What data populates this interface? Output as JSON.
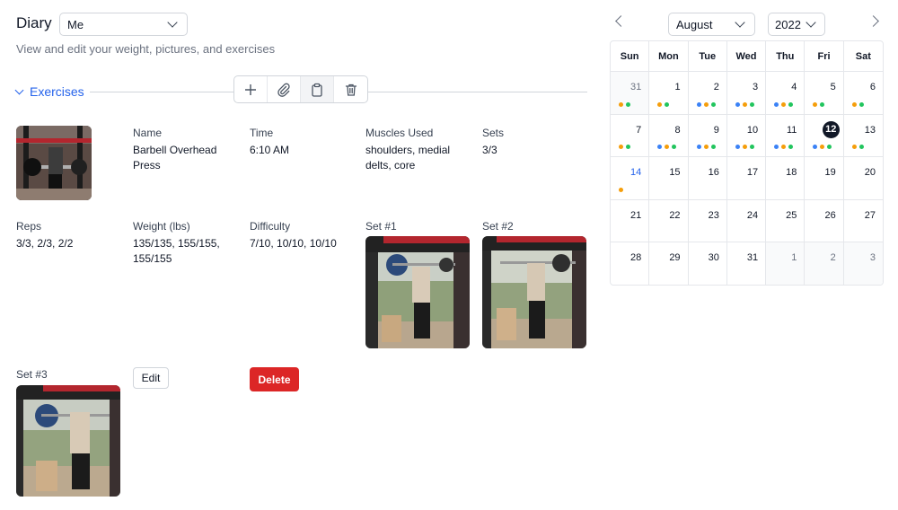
{
  "header": {
    "title": "Diary",
    "user_select": "Me",
    "subtitle": "View and edit your weight, pictures, and exercises"
  },
  "section": {
    "label": "Exercises",
    "toolbar": [
      {
        "name": "add-icon"
      },
      {
        "name": "attach-icon"
      },
      {
        "name": "clipboard-icon"
      },
      {
        "name": "trash-icon"
      }
    ]
  },
  "exercise": {
    "name_label": "Name",
    "name_value": "Barbell Overhead Press",
    "time_label": "Time",
    "time_value": "6:10 AM",
    "muscles_label": "Muscles Used",
    "muscles_value": "shoulders, medial delts, core",
    "sets_label": "Sets",
    "sets_value": "3/3",
    "reps_label": "Reps",
    "reps_value": "3/3, 2/3, 2/2",
    "weight_label": "Weight (lbs)",
    "weight_value": "135/135, 155/155, 155/155",
    "difficulty_label": "Difficulty",
    "difficulty_value": "7/10, 10/10, 10/10",
    "set1_label": "Set #1",
    "set2_label": "Set #2",
    "set3_label": "Set #3",
    "edit_label": "Edit",
    "delete_label": "Delete"
  },
  "calendar": {
    "month": "August",
    "year": "2022",
    "weekdays": [
      "Sun",
      "Mon",
      "Tue",
      "Wed",
      "Thu",
      "Fri",
      "Sat"
    ],
    "days": [
      {
        "d": "31",
        "other": true,
        "dots": [
          "orange",
          "green"
        ]
      },
      {
        "d": "1",
        "dots": [
          "orange",
          "green"
        ]
      },
      {
        "d": "2",
        "dots": [
          "blue",
          "orange",
          "green"
        ]
      },
      {
        "d": "3",
        "dots": [
          "blue",
          "orange",
          "green"
        ]
      },
      {
        "d": "4",
        "dots": [
          "blue",
          "orange",
          "green"
        ]
      },
      {
        "d": "5",
        "dots": [
          "orange",
          "green"
        ]
      },
      {
        "d": "6",
        "dots": [
          "orange",
          "green"
        ]
      },
      {
        "d": "7",
        "dots": [
          "orange",
          "green"
        ]
      },
      {
        "d": "8",
        "dots": [
          "blue",
          "orange",
          "green"
        ]
      },
      {
        "d": "9",
        "dots": [
          "blue",
          "orange",
          "green"
        ]
      },
      {
        "d": "10",
        "dots": [
          "blue",
          "orange",
          "green"
        ]
      },
      {
        "d": "11",
        "dots": [
          "blue",
          "orange",
          "green"
        ]
      },
      {
        "d": "12",
        "selected": true,
        "dots": [
          "blue",
          "orange",
          "green"
        ]
      },
      {
        "d": "13",
        "dots": [
          "orange",
          "green"
        ]
      },
      {
        "d": "14",
        "today": true,
        "dots": [
          "orange"
        ]
      },
      {
        "d": "15",
        "dots": []
      },
      {
        "d": "16",
        "dots": []
      },
      {
        "d": "17",
        "dots": []
      },
      {
        "d": "18",
        "dots": []
      },
      {
        "d": "19",
        "dots": []
      },
      {
        "d": "20",
        "dots": []
      },
      {
        "d": "21",
        "dots": []
      },
      {
        "d": "22",
        "dots": []
      },
      {
        "d": "23",
        "dots": []
      },
      {
        "d": "24",
        "dots": []
      },
      {
        "d": "25",
        "dots": []
      },
      {
        "d": "26",
        "dots": []
      },
      {
        "d": "27",
        "dots": []
      },
      {
        "d": "28",
        "dots": []
      },
      {
        "d": "29",
        "dots": []
      },
      {
        "d": "30",
        "dots": []
      },
      {
        "d": "31",
        "dots": []
      },
      {
        "d": "1",
        "other": true,
        "dots": []
      },
      {
        "d": "2",
        "other": true,
        "dots": []
      },
      {
        "d": "3",
        "other": true,
        "dots": []
      }
    ],
    "dot_colors": {
      "blue": "#3b82f6",
      "orange": "#f59e0b",
      "green": "#22c55e"
    }
  },
  "colors": {
    "accent": "#2563eb",
    "danger": "#dc2626",
    "selected_day": "#111827"
  }
}
